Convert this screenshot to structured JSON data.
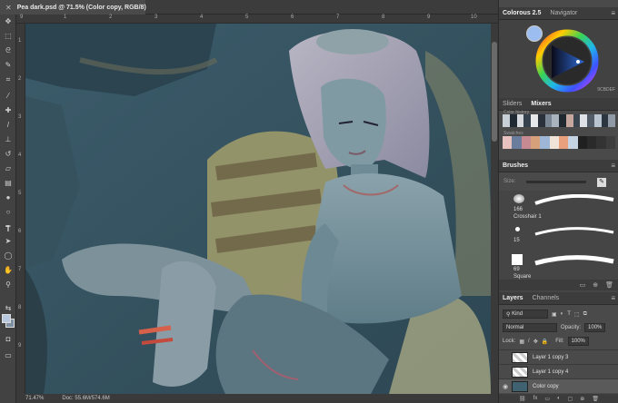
{
  "document": {
    "title": "Pea dark.psd @ 71.5% (Color copy, RGB/8)"
  },
  "ruler_top": [
    "9",
    "1",
    "2",
    "3",
    "4",
    "5",
    "6",
    "7",
    "8",
    "9",
    "10"
  ],
  "ruler_left": [
    "1",
    "2",
    "3",
    "4",
    "5",
    "6",
    "7",
    "8",
    "9"
  ],
  "status": {
    "zoom": "71.47%",
    "doc": "Doc: 55.6M/574.6M"
  },
  "tools": [
    "move-icon",
    "marquee-icon",
    "lasso-icon",
    "quick-select-icon",
    "crop-icon",
    "eyedropper-icon",
    "healing-icon",
    "brush-icon",
    "stamp-icon",
    "history-brush-icon",
    "eraser-icon",
    "gradient-icon",
    "blur-icon",
    "dodge-icon",
    "pen-icon",
    "type-icon",
    "path-select-icon",
    "ellipse-icon",
    "hand-icon",
    "zoom-icon"
  ],
  "colors": {
    "foreground": "#b8c8de",
    "background": "#7d8fa3",
    "accent_blue": "#2f6bd6",
    "canvas_base": "#3f6170"
  },
  "color_panel": {
    "tabs": [
      "Colorous 2.5",
      "Navigator"
    ],
    "active_tab": "Colorous 2.5",
    "hex_value": "9CBDEF"
  },
  "mixer_panel": {
    "tabs": [
      "Sliders",
      "Mixers"
    ],
    "active_tab": "Mixers",
    "history_label": "Color history",
    "swatches_label": "Swatches",
    "history_colors": [
      "#c9cfd6",
      "#1f2a33",
      "#d7dbe0",
      "#36424d",
      "#e6e8ea",
      "#2a313a",
      "#7a8694",
      "#a9b4bf",
      "#202830",
      "#c6a79d",
      "#3a4550",
      "#dfe3e7",
      "#515c68",
      "#b8c4d0",
      "#2c3640",
      "#8f9aa6"
    ],
    "swatch_colors": [
      "#e9c2c0",
      "#6b7d9c",
      "#c58a92",
      "#d6a07a",
      "#9fb7d7",
      "#f0e4d8",
      "#e9a07c",
      "#c6d3e3",
      "#202020",
      "#2a2a2a",
      "#333333",
      "#3d3d3d"
    ]
  },
  "brushes_panel": {
    "title": "Brushes",
    "size_label": "Size:",
    "items": [
      {
        "num": "166",
        "name": "Crosshair 1"
      },
      {
        "num": "15",
        "name": ""
      },
      {
        "num": "69",
        "name": "Square"
      }
    ]
  },
  "layers_panel": {
    "tabs": [
      "Layers",
      "Channels"
    ],
    "active_tab": "Layers",
    "kind_label": "Kind",
    "blend_mode": "Normal",
    "opacity_label": "Opacity:",
    "opacity_value": "100%",
    "lock_label": "Lock:",
    "fill_label": "Fill:",
    "fill_value": "100%",
    "layers": [
      {
        "name": "Layer 1 copy 3",
        "visible": false,
        "active": false
      },
      {
        "name": "Layer 1 copy 4",
        "visible": false,
        "active": false
      },
      {
        "name": "Color copy",
        "visible": true,
        "active": true
      }
    ],
    "footer": [
      "fx",
      "◐",
      "▭",
      "▢",
      "⊕",
      "🗑"
    ]
  }
}
